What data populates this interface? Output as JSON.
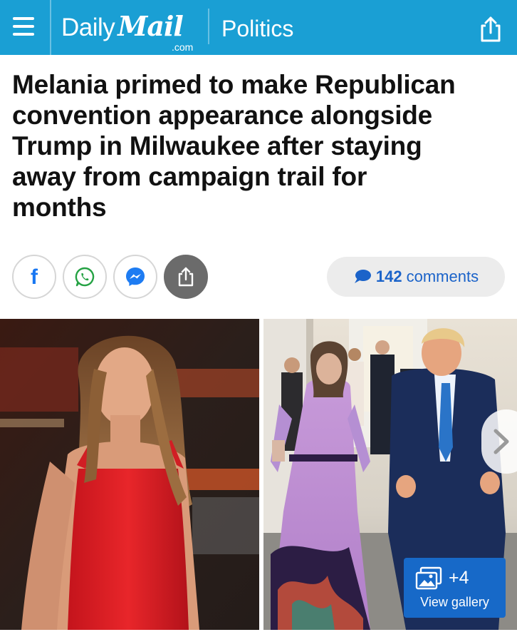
{
  "header": {
    "logo_daily": "Daily",
    "logo_mail": "Mail",
    "logo_com": ".com",
    "section": "Politics",
    "bg_color": "#1a9fd4"
  },
  "article": {
    "headline_lines": [
      "Melania primed to make Republican",
      "convention appearance alongside",
      "Trump in Milwaukee after staying",
      "away from campaign trail for",
      "months"
    ]
  },
  "social": {
    "facebook_letter": "f",
    "comments_count": "142",
    "comments_label": "comments"
  },
  "gallery": {
    "count": "+4",
    "label": "View gallery"
  }
}
